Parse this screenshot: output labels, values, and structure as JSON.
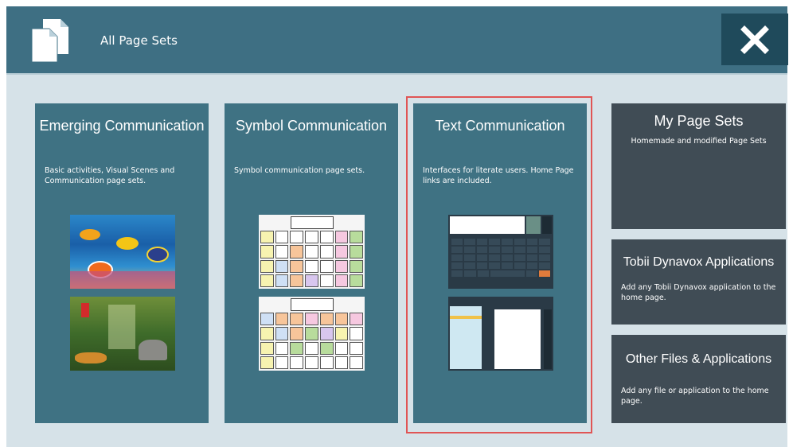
{
  "header": {
    "title": "All Page Sets",
    "close_icon": "close-x-icon",
    "app_icon": "page-sets-icon"
  },
  "cards": [
    {
      "title": "Emerging Communication",
      "description": "Basic activities, Visual Scenes and Communication page sets."
    },
    {
      "title": "Symbol Communication",
      "description": "Symbol communication page sets."
    },
    {
      "title": "Text Communication",
      "description": "Interfaces for literate users. Home Page links are included."
    }
  ],
  "side_cards": [
    {
      "title": "My Page Sets",
      "description": "Homemade and modified Page Sets"
    },
    {
      "title": "Tobii Dynavox Applications",
      "description": "Add any Tobii Dynavox application to the home page."
    },
    {
      "title": "Other Files & Applications",
      "description": "Add any file or application to the home page."
    }
  ],
  "colors": {
    "header": "#3e6f83",
    "card": "#3f7283",
    "side_card": "#404c55",
    "background": "#d6e2e8",
    "selection_outline": "#e05555"
  }
}
